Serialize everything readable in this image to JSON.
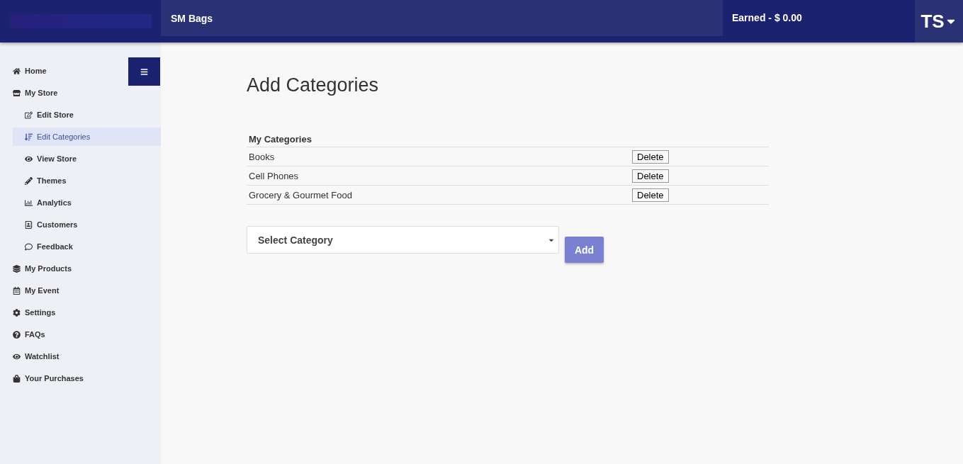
{
  "header": {
    "store_name": "SM Bags",
    "earned": "Earned - $ 0.00",
    "user_initials": "TS"
  },
  "sidebar": {
    "items": [
      {
        "label": "Home",
        "selected": false
      },
      {
        "label": "My Store",
        "selected": false,
        "children": [
          {
            "label": "Edit Store",
            "selected": false
          },
          {
            "label": "Edit Categories",
            "selected": true
          },
          {
            "label": "View Store",
            "selected": false
          },
          {
            "label": "Themes",
            "selected": false
          },
          {
            "label": "Analytics",
            "selected": false
          },
          {
            "label": "Customers",
            "selected": false
          },
          {
            "label": "Feedback",
            "selected": false
          }
        ]
      },
      {
        "label": "My Products",
        "selected": false
      },
      {
        "label": "My Event",
        "selected": false
      },
      {
        "label": "Settings",
        "selected": false
      },
      {
        "label": "FAQs",
        "selected": false
      },
      {
        "label": "Watchlist",
        "selected": false
      },
      {
        "label": "Your Purchases",
        "selected": false
      }
    ]
  },
  "page": {
    "title": "Add Categories",
    "table": {
      "columns": [
        "My Categories"
      ],
      "rows": [
        {
          "name": "Books",
          "action": "Delete"
        },
        {
          "name": "Cell Phones",
          "action": "Delete"
        },
        {
          "name": "Grocery & Gourmet Food",
          "action": "Delete"
        }
      ]
    },
    "select": {
      "placeholder": "Select Category"
    },
    "add_button": "Add"
  }
}
